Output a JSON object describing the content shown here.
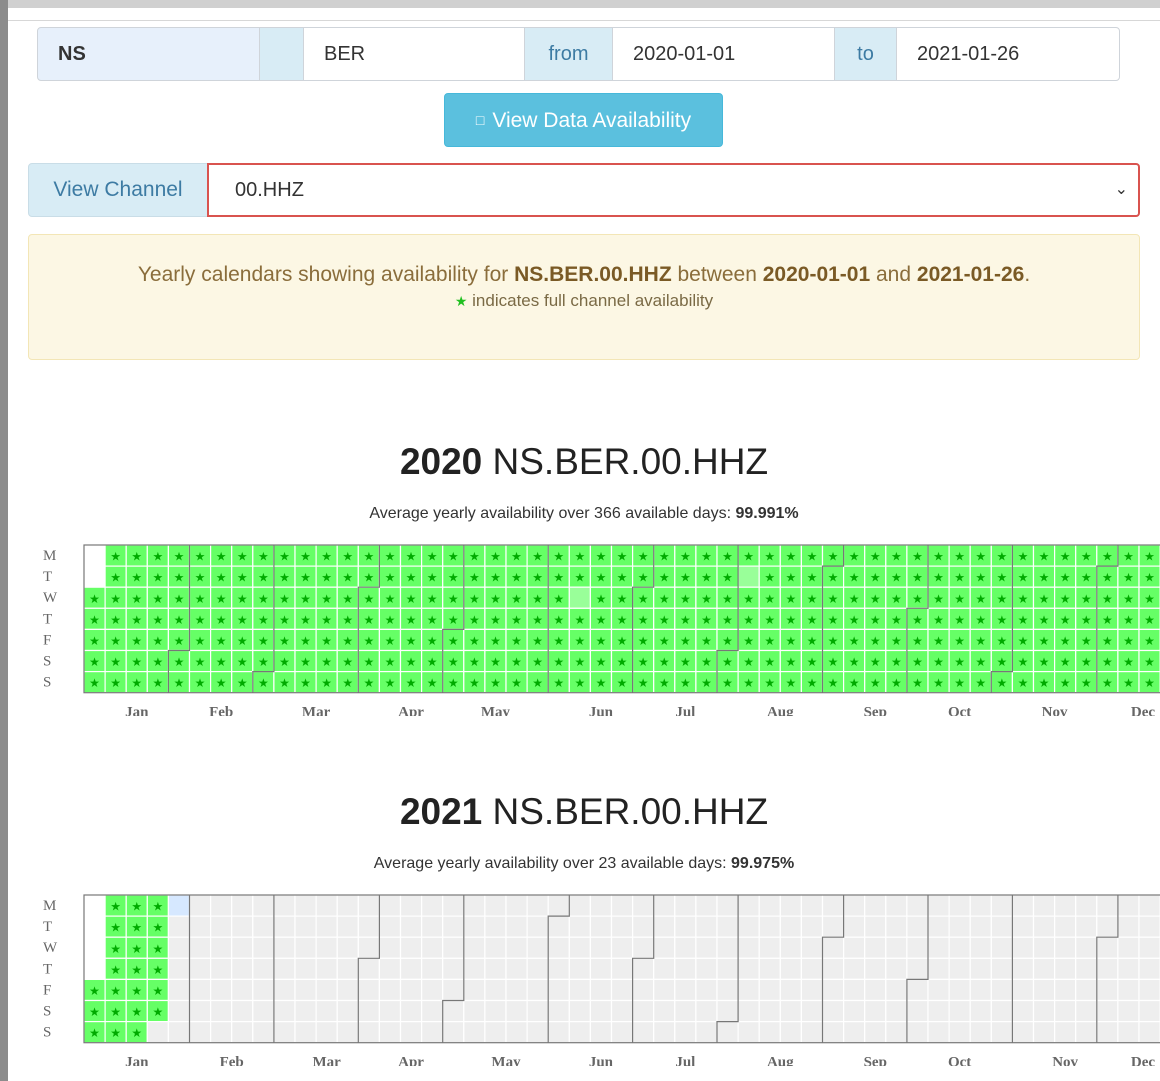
{
  "form": {
    "network": "NS",
    "station": "BER",
    "from_label": "from",
    "start_date": "2020-01-01",
    "to_label": "to",
    "end_date": "2021-01-26",
    "view_button": "View Data Availability",
    "view_button_icon": "info-icon"
  },
  "channel": {
    "label": "View Channel",
    "selected": "00.HHZ"
  },
  "notice": {
    "prefix": "Yearly calendars showing availability for",
    "channel_id": "NS.BER.00.HHZ",
    "between": "between",
    "start": "2020-01-01",
    "and": "and",
    "end": "2021-01-26",
    "period": ".",
    "star": "★",
    "legend": "indicates full channel availability"
  },
  "weekday_labels": [
    "M",
    "T",
    "W",
    "T",
    "F",
    "S",
    "S"
  ],
  "month_labels": [
    "Jan",
    "Feb",
    "Mar",
    "Apr",
    "May",
    "Jun",
    "Jul",
    "Aug",
    "Sep",
    "Oct",
    "Nov",
    "Dec"
  ],
  "colors": {
    "available": "#66ff66",
    "partial": "#99ff99",
    "empty": "#eeeeee",
    "today": "#d6e8ff",
    "star": "#00aa00",
    "accent": "#5bc0de",
    "select_border": "#d9534f"
  },
  "years": [
    {
      "year": "2020",
      "channel": "NS.BER.00.HHZ",
      "avg_prefix": "Average yearly availability over 366 available days:",
      "avg_value": "99.991%",
      "available_until": "2020-12-31",
      "partial_days": [
        "2020-06-10",
        "2020-08-04"
      ]
    },
    {
      "year": "2021",
      "channel": "NS.BER.00.HHZ",
      "avg_prefix": "Average yearly availability over 23 available days:",
      "avg_value": "99.975%",
      "available_until": "2021-01-23",
      "highlight_day": "2021-01-25",
      "partial_days": []
    }
  ]
}
